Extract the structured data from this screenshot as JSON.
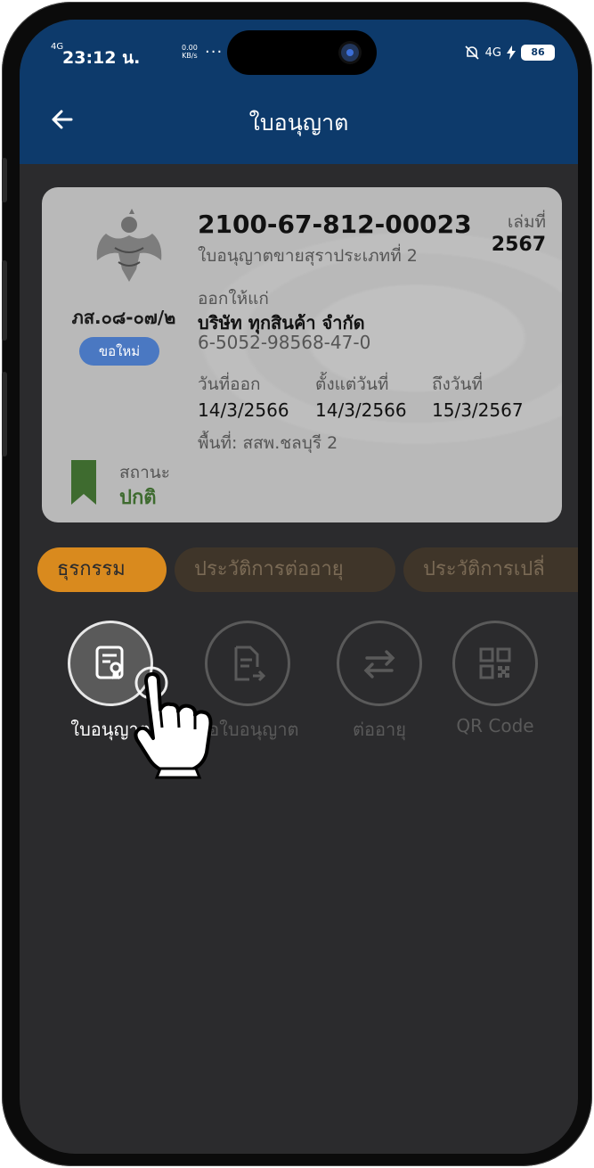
{
  "status_bar": {
    "signal": "4G",
    "time": "23:12 น.",
    "speed_value": "0.00",
    "speed_unit": "KB/s",
    "dots": "···",
    "network_right": "4G",
    "battery": "86"
  },
  "header": {
    "title": "ใบอนุญาต"
  },
  "card": {
    "form_code": "ภส.๐๘-๐๗/๒",
    "badge": "ขอใหม่",
    "license_no": "2100-67-812-00023",
    "license_type": "ใบอนุญาตขายสุราประเภทที่ 2",
    "book_label": "เล่มที่",
    "book_value": "2567",
    "issued_label": "ออกให้แก่",
    "issued_name": "บริษัท ทุกสินค้า จำกัด",
    "tax_id": "6-5052-98568-47-0",
    "dates": [
      {
        "label": "วันที่ออก",
        "value": "14/3/2566"
      },
      {
        "label": "ตั้งแต่วันที่",
        "value": "14/3/2566"
      },
      {
        "label": "ถึงวันที่",
        "value": "15/3/2567"
      }
    ],
    "area": "พื้นที่: สสพ.ชลบุรี 2",
    "status_label": "สถานะ",
    "status_value": "ปกติ"
  },
  "tabs": [
    {
      "label": "ธุรกรรม",
      "active": true
    },
    {
      "label": "ประวัติการต่ออายุ",
      "active": false
    },
    {
      "label": "ประวัติการเปลี่",
      "active": false
    }
  ],
  "actions": [
    {
      "label": "ใบอนุญาต",
      "icon": "certificate-icon",
      "selected": true
    },
    {
      "label": "ขอใบอนุญาต",
      "icon": "document-export-icon",
      "selected": false
    },
    {
      "label": "ต่ออายุ",
      "icon": "renew-icon",
      "selected": false
    },
    {
      "label": "QR Code",
      "icon": "qr-code-icon",
      "selected": false
    }
  ],
  "colors": {
    "header": "#0d3a6b",
    "background": "#2b2b2d",
    "card": "#b9b9b9",
    "tab_active": "#d98a1e",
    "status_green": "#3e6b2f",
    "badge_blue": "#4a78c2"
  }
}
